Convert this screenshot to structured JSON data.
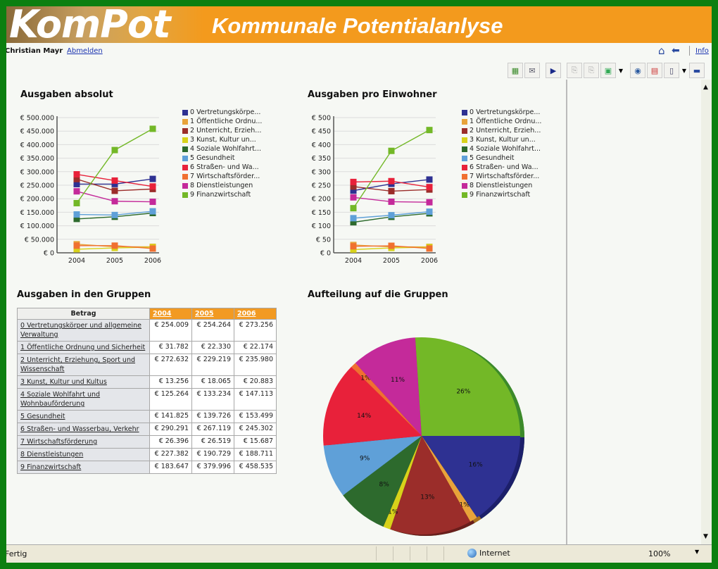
{
  "header": {
    "logo": "KomPot",
    "subtitle": "Kommunale Potentialanlyse"
  },
  "userbar": {
    "user": "Christian Mayr",
    "logout": "Abmelden",
    "info": "Info"
  },
  "toolbar": {
    "icons": [
      "excel-export-icon",
      "mail-icon",
      "play-icon",
      "copy-icon",
      "paste-icon",
      "chart-settings-icon",
      "dropdown",
      "camera-icon",
      "report-icon",
      "page-icon",
      "dropdown",
      "bookmark-icon"
    ]
  },
  "colors": {
    "banner": "#f39a1d",
    "series": [
      "#2e3192",
      "#e8a33a",
      "#9b2d2a",
      "#d8d21a",
      "#2d6a2d",
      "#5fa0d8",
      "#e8213a",
      "#f07030",
      "#c42a9a",
      "#73b827"
    ]
  },
  "series_labels": [
    "0 Vertretungskörpe...",
    "1 Öffentliche Ordnu...",
    "2 Unterricht, Erzieh...",
    "3 Kunst, Kultur un...",
    "4 Soziale Wohlfahrt...",
    "5 Gesundheit",
    "6 Straßen- und Wa...",
    "7 Wirtschaftsförder...",
    "8 Dienstleistungen",
    "9 Finanzwirtschaft"
  ],
  "chart_data": [
    {
      "type": "line",
      "title": "Ausgaben absolut",
      "categories": [
        "2004",
        "2005",
        "2006"
      ],
      "ylim": [
        0,
        500000
      ],
      "yticks": [
        "€ 0",
        "€ 50.000",
        "€ 100.000",
        "€ 150.000",
        "€ 200.000",
        "€ 250.000",
        "€ 300.000",
        "€ 350.000",
        "€ 400.000",
        "€ 450.000",
        "€ 500.000"
      ],
      "legend": "right",
      "grid": true,
      "series": [
        {
          "name": "0 Vertretungskörpe...",
          "values": [
            254009,
            254264,
            273256
          ]
        },
        {
          "name": "1 Öffentliche Ordnu...",
          "values": [
            31782,
            22330,
            22174
          ]
        },
        {
          "name": "2 Unterricht, Erzieh...",
          "values": [
            272632,
            229219,
            235980
          ]
        },
        {
          "name": "3 Kunst, Kultur un...",
          "values": [
            13256,
            18065,
            20883
          ]
        },
        {
          "name": "4 Soziale Wohlfahrt...",
          "values": [
            125264,
            133234,
            147113
          ]
        },
        {
          "name": "5 Gesundheit",
          "values": [
            141825,
            139726,
            153499
          ]
        },
        {
          "name": "6 Straßen- und Wa...",
          "values": [
            290291,
            267119,
            245302
          ]
        },
        {
          "name": "7 Wirtschaftsförder...",
          "values": [
            26396,
            26519,
            15687
          ]
        },
        {
          "name": "8 Dienstleistungen",
          "values": [
            227382,
            190729,
            188711
          ]
        },
        {
          "name": "9 Finanzwirtschaft",
          "values": [
            183647,
            379996,
            458535
          ]
        }
      ]
    },
    {
      "type": "line",
      "title": "Ausgaben pro Einwohner",
      "categories": [
        "2004",
        "2005",
        "2006"
      ],
      "ylim": [
        0,
        500
      ],
      "yticks": [
        "€ 0",
        "€ 50",
        "€ 100",
        "€ 150",
        "€ 200",
        "€ 250",
        "€ 300",
        "€ 350",
        "€ 400",
        "€ 450",
        "€ 500"
      ],
      "legend": "right",
      "grid": true,
      "series": [
        {
          "name": "0 Vertretungskörpe...",
          "values": [
            230,
            255,
            271
          ]
        },
        {
          "name": "1 Öffentliche Ordnu...",
          "values": [
            29,
            22,
            22
          ]
        },
        {
          "name": "2 Unterricht, Erzieh...",
          "values": [
            245,
            228,
            234
          ]
        },
        {
          "name": "3 Kunst, Kultur un...",
          "values": [
            12,
            18,
            21
          ]
        },
        {
          "name": "4 Soziale Wohlfahrt...",
          "values": [
            113,
            133,
            146
          ]
        },
        {
          "name": "5 Gesundheit",
          "values": [
            128,
            139,
            152
          ]
        },
        {
          "name": "6 Straßen- und Wa...",
          "values": [
            262,
            265,
            243
          ]
        },
        {
          "name": "7 Wirtschaftsförder...",
          "values": [
            24,
            26,
            16
          ]
        },
        {
          "name": "8 Dienstleistungen",
          "values": [
            205,
            189,
            187
          ]
        },
        {
          "name": "9 Finanzwirtschaft",
          "values": [
            165,
            377,
            454
          ]
        }
      ]
    },
    {
      "type": "pie",
      "title": "Aufteilung auf die Gruppen",
      "labels": [
        "0",
        "1",
        "2",
        "3",
        "4",
        "5",
        "6",
        "7",
        "8",
        "9"
      ],
      "values": [
        273256,
        22174,
        235980,
        20883,
        147113,
        153499,
        245302,
        15687,
        188711,
        458535
      ],
      "percent_labels": [
        "16%",
        "1%",
        "13%",
        "1%",
        "8%",
        "9%",
        "14%",
        "1%",
        "11%",
        "26%"
      ]
    }
  ],
  "table": {
    "title": "Ausgaben in den Gruppen",
    "header": [
      "Betrag",
      "2004",
      "2005",
      "2006"
    ],
    "rows": [
      {
        "label": "0 Vertretungskörper und allgemeine Verwaltung",
        "v": [
          "€ 254.009",
          "€ 254.264",
          "€ 273.256"
        ]
      },
      {
        "label": "1 Öffentliche Ordnung und Sicherheit",
        "v": [
          "€ 31.782",
          "€ 22.330",
          "€ 22.174"
        ]
      },
      {
        "label": "2 Unterricht, Erziehung, Sport und Wissenschaft",
        "v": [
          "€ 272.632",
          "€ 229.219",
          "€ 235.980"
        ]
      },
      {
        "label": "3 Kunst, Kultur und Kultus",
        "v": [
          "€ 13.256",
          "€ 18.065",
          "€ 20.883"
        ]
      },
      {
        "label": "4 Soziale Wohlfahrt und Wohnbauförderung",
        "v": [
          "€ 125.264",
          "€ 133.234",
          "€ 147.113"
        ]
      },
      {
        "label": "5 Gesundheit",
        "v": [
          "€ 141.825",
          "€ 139.726",
          "€ 153.499"
        ]
      },
      {
        "label": "6 Straßen- und Wasserbau, Verkehr",
        "v": [
          "€ 290.291",
          "€ 267.119",
          "€ 245.302"
        ]
      },
      {
        "label": "7 Wirtschaftsförderung",
        "v": [
          "€ 26.396",
          "€ 26.519",
          "€ 15.687"
        ]
      },
      {
        "label": "8 Dienstleistungen",
        "v": [
          "€ 227.382",
          "€ 190.729",
          "€ 188.711"
        ]
      },
      {
        "label": "9 Finanzwirtschaft",
        "v": [
          "€ 183.647",
          "€ 379.996",
          "€ 458.535"
        ]
      }
    ]
  },
  "statusbar": {
    "status": "Fertig",
    "zone": "Internet",
    "zoom": "100%"
  }
}
